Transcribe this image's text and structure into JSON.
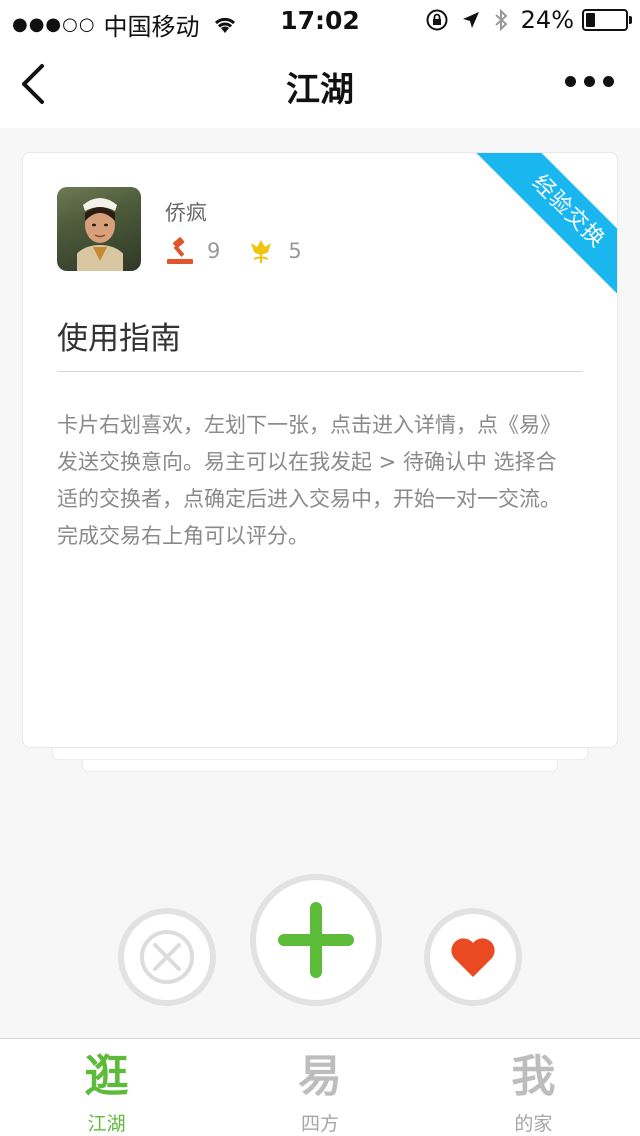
{
  "status_bar": {
    "signal": "●●●○○",
    "carrier": "中国移动",
    "time": "17:02",
    "battery_text": "24%",
    "battery_level": 0.24
  },
  "nav": {
    "title": "江湖"
  },
  "card": {
    "user_name": "侨疯",
    "stats": {
      "gavel_count": "9",
      "flower_count": "5"
    },
    "ribbon": "经验交换",
    "title": "使用指南",
    "body": "卡片右划喜欢，左划下一张，点击进入详情，点《易》发送交换意向。易主可以在我发起 > 待确认中 选择合适的交换者，点确定后进入交易中，开始一对一交流。完成交易右上角可以评分。"
  },
  "tabs": [
    {
      "icon": "逛",
      "label": "江湖",
      "active": true
    },
    {
      "icon": "易",
      "label": "四方",
      "active": false
    },
    {
      "icon": "我",
      "label": "的家",
      "active": false
    }
  ],
  "colors": {
    "accent_green": "#5dbb3a",
    "ribbon_blue": "#1ab6f0",
    "heart_red": "#ea4a22",
    "gavel_red": "#e0562a",
    "flower_yellow": "#f1c40f"
  }
}
